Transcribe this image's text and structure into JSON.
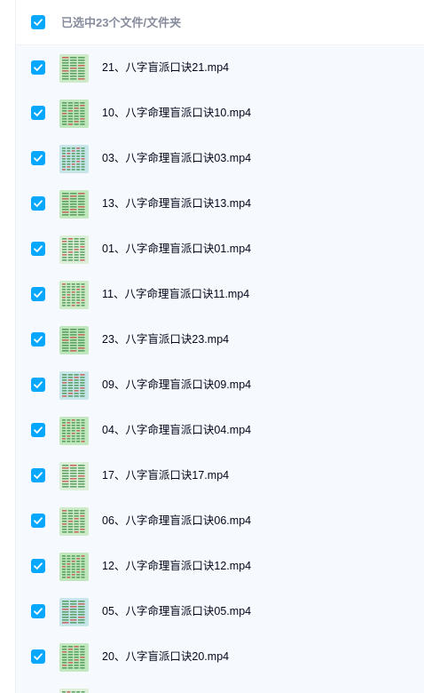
{
  "header": {
    "select_all_label": "已选中23个文件/文件夹",
    "checked": true
  },
  "colors": {
    "accent": "#06a7ff",
    "panel_bg": "#f6fafe",
    "text": "#03081a",
    "muted_text": "#878c9c"
  },
  "files": [
    {
      "name": "21、八字盲派口诀21.mp4",
      "checked": true,
      "thumb": "doc-thumbnail-icon"
    },
    {
      "name": "10、八字命理盲派口诀10.mp4",
      "checked": true,
      "thumb": "doc-thumbnail-icon"
    },
    {
      "name": "03、八字命理盲派口诀03.mp4",
      "checked": true,
      "thumb": "doc-thumbnail-icon"
    },
    {
      "name": "13、八字命理盲派口诀13.mp4",
      "checked": true,
      "thumb": "doc-thumbnail-icon"
    },
    {
      "name": "01、八字命理盲派口诀01.mp4",
      "checked": true,
      "thumb": "doc-thumbnail-icon"
    },
    {
      "name": "11、八字命理盲派口诀11.mp4",
      "checked": true,
      "thumb": "doc-thumbnail-icon"
    },
    {
      "name": "23、八字盲派口诀23.mp4",
      "checked": true,
      "thumb": "doc-thumbnail-icon"
    },
    {
      "name": "09、八字命理盲派口诀09.mp4",
      "checked": true,
      "thumb": "doc-thumbnail-icon"
    },
    {
      "name": "04、八字命理盲派口诀04.mp4",
      "checked": true,
      "thumb": "doc-thumbnail-icon"
    },
    {
      "name": "17、八字盲派口诀17.mp4",
      "checked": true,
      "thumb": "doc-thumbnail-icon"
    },
    {
      "name": "06、八字命理盲派口诀06.mp4",
      "checked": true,
      "thumb": "doc-thumbnail-icon"
    },
    {
      "name": "12、八字命理盲派口诀12.mp4",
      "checked": true,
      "thumb": "doc-thumbnail-icon"
    },
    {
      "name": "05、八字命理盲派口诀05.mp4",
      "checked": true,
      "thumb": "doc-thumbnail-icon"
    },
    {
      "name": "20、八字盲派口诀20.mp4",
      "checked": true,
      "thumb": "doc-thumbnail-icon"
    },
    {
      "name": "",
      "checked": true,
      "thumb": "doc-thumbnail-icon"
    }
  ]
}
